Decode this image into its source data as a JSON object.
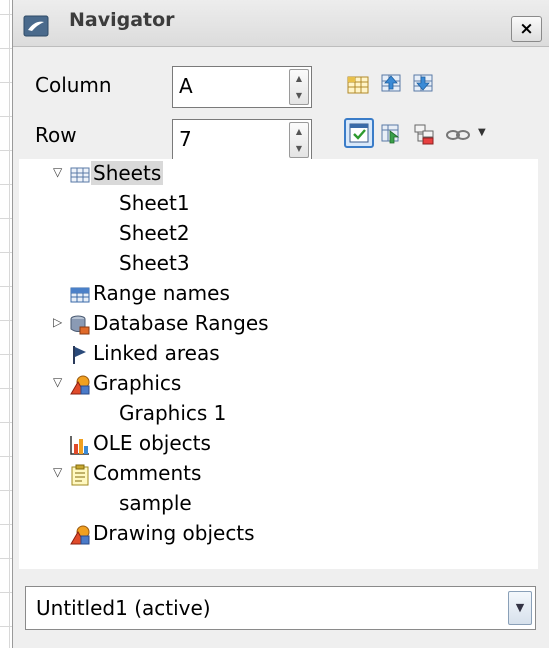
{
  "window": {
    "title": "Navigator",
    "close_label": "×"
  },
  "column": {
    "label": "Column",
    "value": "A"
  },
  "row": {
    "label": "Row",
    "value": "7"
  },
  "toolbar": {
    "icons": [
      "data-range-icon",
      "start-icon",
      "end-icon",
      "contents-toggle-icon",
      "toggle-icon",
      "scenarios-icon",
      "drag-mode-icon"
    ]
  },
  "tree": {
    "sheets": {
      "label": "Sheets",
      "children": [
        "Sheet1",
        "Sheet2",
        "Sheet3"
      ]
    },
    "range_names": {
      "label": "Range names"
    },
    "database_ranges": {
      "label": "Database Ranges"
    },
    "linked_areas": {
      "label": "Linked areas"
    },
    "graphics": {
      "label": "Graphics",
      "children": [
        "Graphics 1"
      ]
    },
    "ole_objects": {
      "label": "OLE objects"
    },
    "comments": {
      "label": "Comments",
      "children": [
        "sample"
      ]
    },
    "drawing_objects": {
      "label": "Drawing objects"
    }
  },
  "document_select": {
    "value": "Untitled1 (active)"
  }
}
